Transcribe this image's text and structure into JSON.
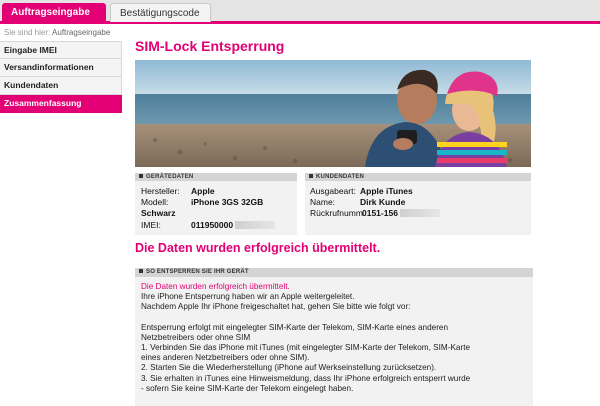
{
  "tabs": [
    {
      "label": "Auftragseingabe",
      "active": true
    },
    {
      "label": "Bestätigungscode",
      "active": false
    }
  ],
  "breadcrumb": {
    "prefix": "Sie sind hier:",
    "current": "Auftragseingabe"
  },
  "nav": [
    {
      "label": "Eingabe IMEI"
    },
    {
      "label": "Versandinformationen"
    },
    {
      "label": "Kundendaten"
    },
    {
      "label": "Zusammenfassung",
      "active": true
    }
  ],
  "page_title": "SIM-Lock Entsperrung",
  "device": {
    "heading": "GERÄTEDATEN",
    "rows": [
      {
        "label": "Hersteller:",
        "value": "Apple"
      },
      {
        "label": "Modell:",
        "value": "iPhone 3GS 32GB"
      },
      {
        "label": "",
        "value": "Schwarz"
      },
      {
        "label": "IMEI:",
        "value": "011950000"
      }
    ]
  },
  "customer": {
    "heading": "KUNDENDATEN",
    "rows": [
      {
        "label": "Ausgabeart:",
        "value": "Apple iTunes"
      },
      {
        "label": "Name:",
        "value": "Dirk Kunde"
      },
      {
        "label": "Rückrufnumm",
        "value": "0151-156"
      }
    ]
  },
  "success_message": "Die Daten wurden erfolgreich übermittelt.",
  "unlock_section": {
    "heading": "SO ENTSPERREN SIE IHR GERÄT",
    "lines": [
      {
        "text": "Die Daten wurden erfolgreich übermittelt.",
        "pink": true
      },
      {
        "text": "Ihre iPhone Entsperrung haben wir an Apple weitergeleitet."
      },
      {
        "text": "Nachdem Apple Ihr iPhone freigeschaltet hat, gehen Sie bitte wie folgt vor:"
      },
      {
        "text": "",
        "gap": true
      },
      {
        "text": "Entsperrung erfolgt mit eingelegter SIM-Karte der Telekom, SIM-Karte eines anderen"
      },
      {
        "text": "Netzbetreibers oder ohne SIM"
      },
      {
        "text": "1. Verbinden Sie das iPhone mit iTunes (mit eingelegter SIM-Karte der Telekom, SIM-Karte"
      },
      {
        "text": "eines anderen Netzbetreibers oder ohne SIM)."
      },
      {
        "text": "2. Starten Sie die Wiederherstellung (iPhone auf Werkseinstellung zurücksetzen)."
      },
      {
        "text": "3. Sie erhalten in iTunes eine Hinweismeldung, dass Ihr iPhone erfolgreich entsperrt wurde"
      },
      {
        "text": "- sofern Sie keine SIM-Karte der Telekom eingelegt haben."
      }
    ]
  },
  "colors": {
    "brand": "#e20074",
    "panel": "#f2f2f2",
    "panel_head": "#d4d4d4"
  }
}
